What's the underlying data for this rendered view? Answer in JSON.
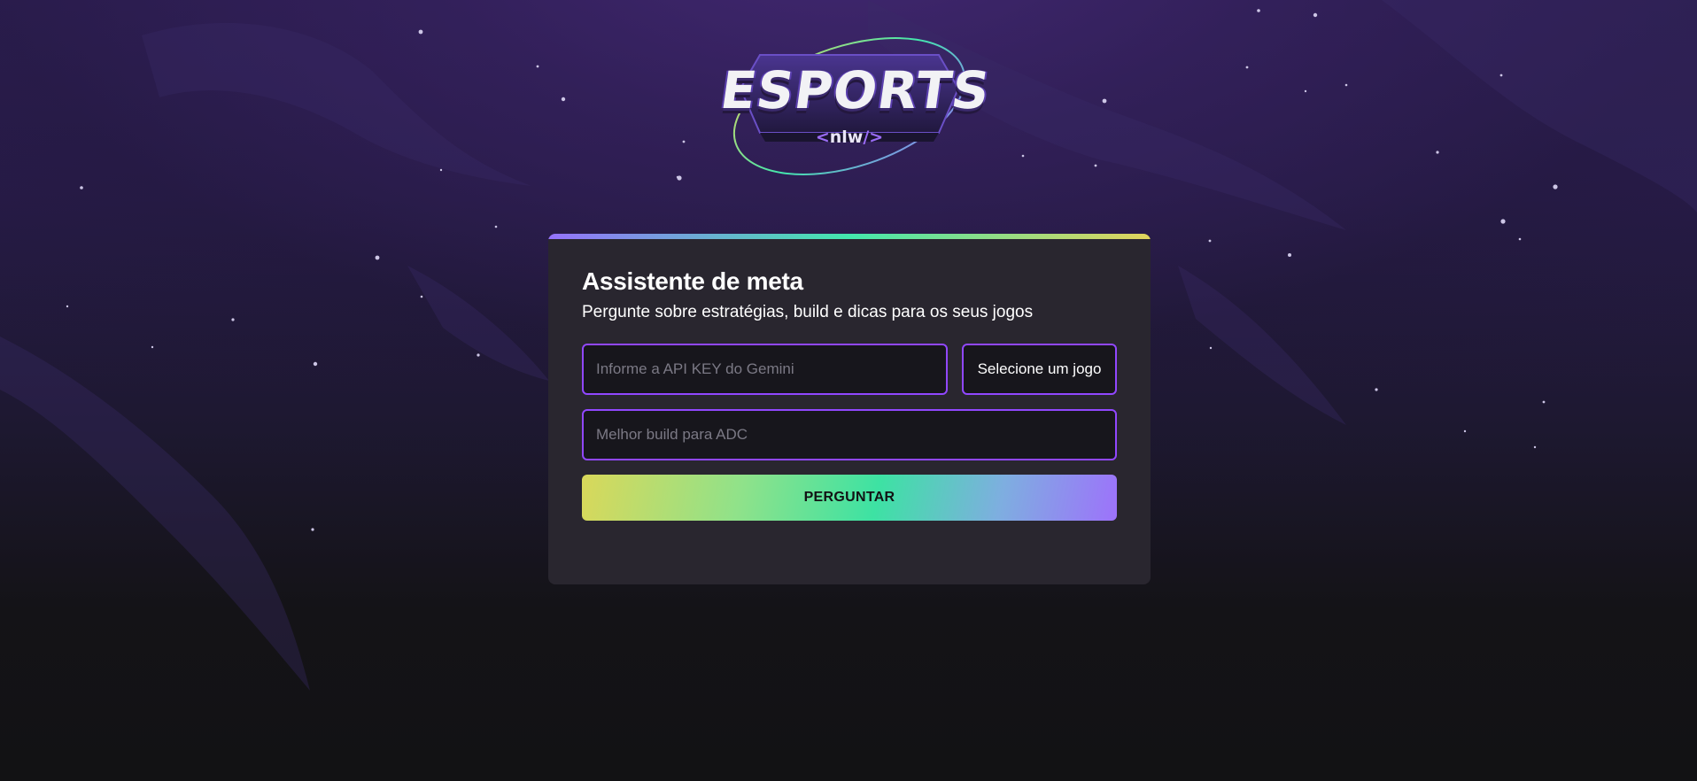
{
  "logo": {
    "wordmark": "ESPORTS",
    "sub_open": "<",
    "sub_text": "nlw",
    "sub_close": "/>"
  },
  "card": {
    "title": "Assistente de meta",
    "subtitle": "Pergunte sobre estratégias, build e dicas para os seus jogos"
  },
  "form": {
    "api_key_placeholder": "Informe a API KEY do Gemini",
    "api_key_value": "",
    "game_select_value": "Selecione um jogo",
    "question_placeholder": "Melhor build para ADC",
    "question_value": "",
    "submit_label": "PERGUNTAR"
  },
  "colors": {
    "page_background": "#121214",
    "card_background": "#29262f",
    "field_background": "#17161c",
    "field_border": "#9147ff",
    "gradient_start": "#9572fc",
    "gradient_middle": "#43e7ad",
    "gradient_end": "#e2d45c"
  }
}
